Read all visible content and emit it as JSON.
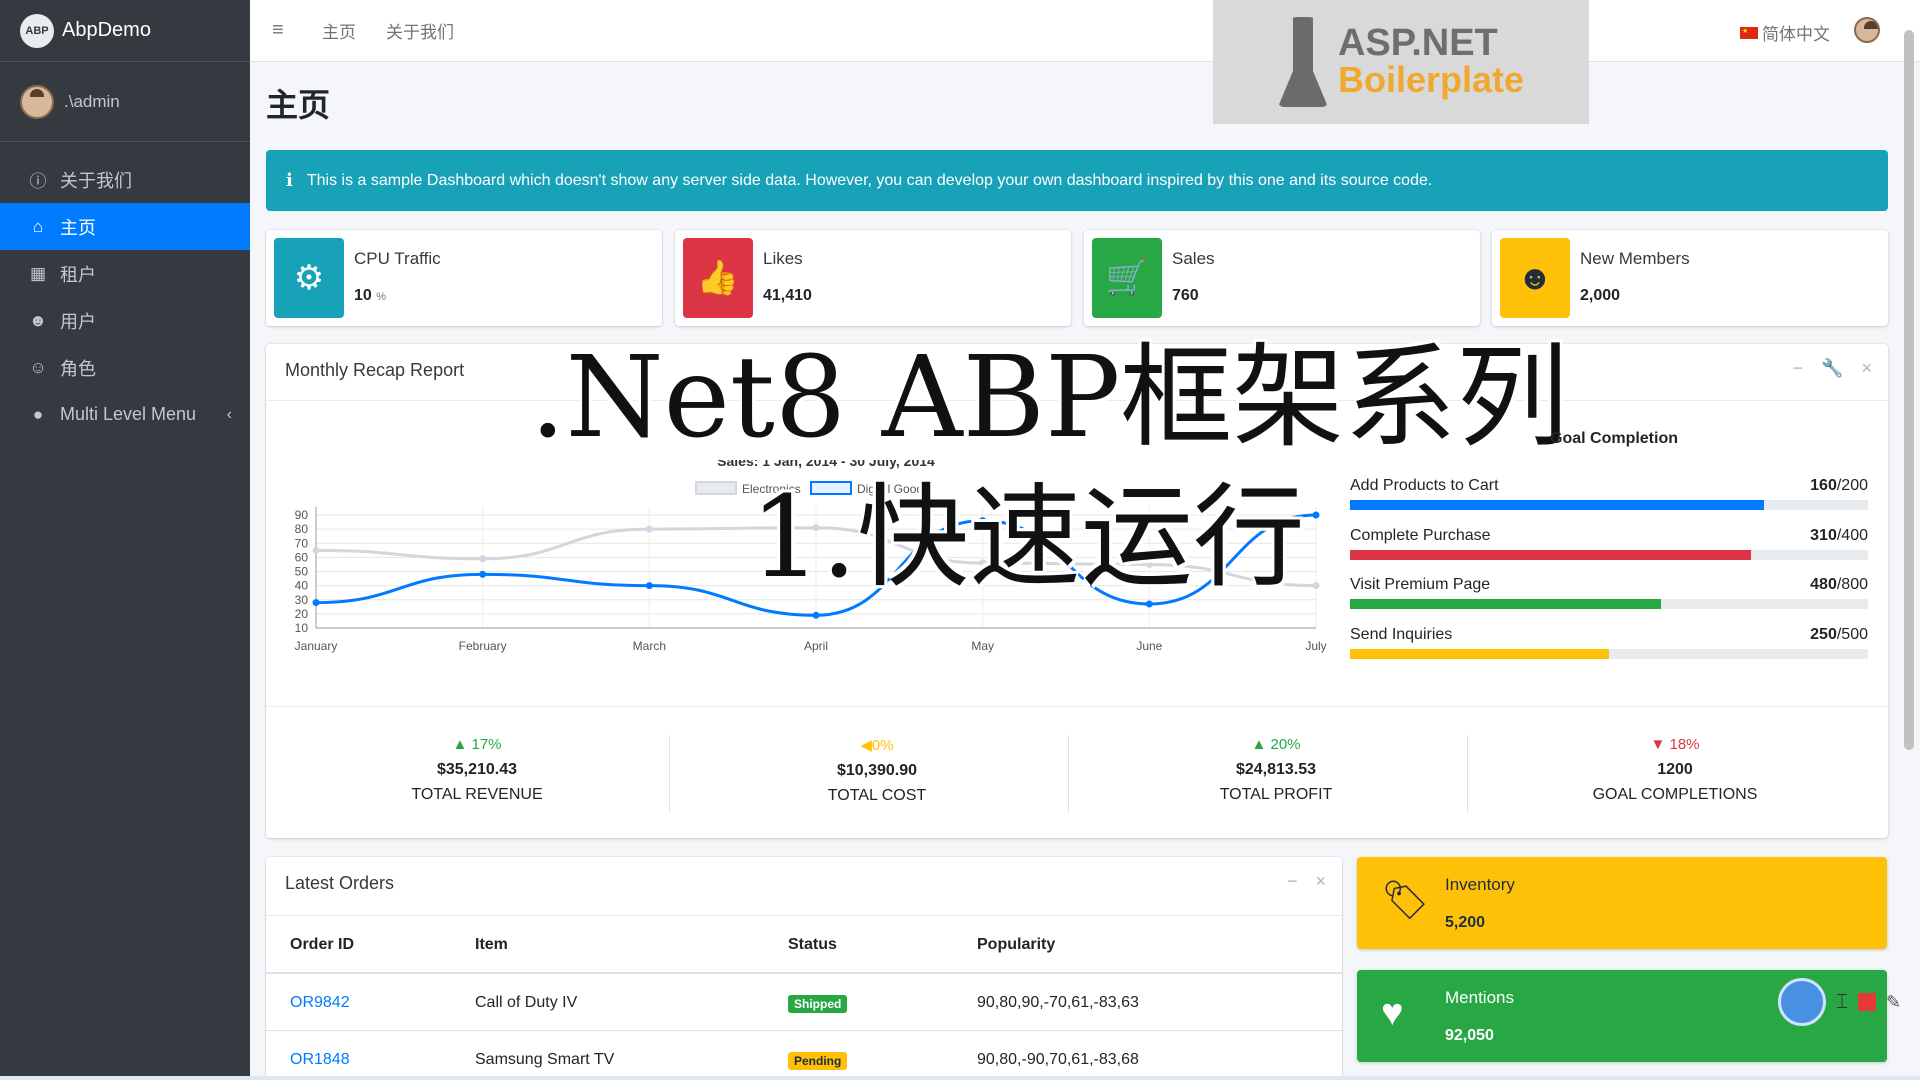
{
  "sidebar": {
    "brand": "AbpDemo",
    "brand_logo": "ABP",
    "user": ".\\admin",
    "items": [
      {
        "label": "关于我们",
        "icon": "info-circle-icon"
      },
      {
        "label": "主页",
        "icon": "home-icon"
      },
      {
        "label": "租户",
        "icon": "building-icon"
      },
      {
        "label": "用户",
        "icon": "users-icon"
      },
      {
        "label": "角色",
        "icon": "theater-masks-icon"
      },
      {
        "label": "Multi Level Menu",
        "icon": "circle-icon"
      }
    ]
  },
  "topbar": {
    "links": [
      "主页",
      "关于我们"
    ],
    "language": "简体中文"
  },
  "watermark": {
    "line1": "ASP.NET",
    "line2": "Boilerplate"
  },
  "page_title": "主页",
  "alert": "This is a sample Dashboard which doesn't show any server side data. However, you can develop your own dashboard inspired by this one and its source code.",
  "info_boxes": [
    {
      "label": "CPU Traffic",
      "value": "10",
      "unit": "%",
      "color": "#17a2b8",
      "icon": "gear-icon"
    },
    {
      "label": "Likes",
      "value": "41,410",
      "unit": "",
      "color": "#dc3545",
      "icon": "thumbs-up-icon"
    },
    {
      "label": "Sales",
      "value": "760",
      "unit": "",
      "color": "#28a745",
      "icon": "shopping-cart-icon"
    },
    {
      "label": "New Members",
      "value": "2,000",
      "unit": "",
      "color": "#ffc107",
      "icon": "users-icon"
    }
  ],
  "recap": {
    "title": "Monthly Recap Report",
    "overlay_title": ".Net8 ABP框架系列",
    "overlay_subtitle": "1.快速运行",
    "goal_title": "Goal Completion",
    "goals": [
      {
        "label": "Add Products to Cart",
        "value": "160",
        "max": "/200",
        "fraction": 0.8,
        "color": "#007bff"
      },
      {
        "label": "Complete Purchase",
        "value": "310",
        "max": "/400",
        "fraction": 0.775,
        "color": "#dc3545"
      },
      {
        "label": "Visit Premium Page",
        "value": "480",
        "max": "/800",
        "fraction": 0.6,
        "color": "#28a745"
      },
      {
        "label": "Send Inquiries",
        "value": "250",
        "max": "/500",
        "fraction": 0.5,
        "color": "#ffc107"
      }
    ],
    "stats": [
      {
        "pct": "17%",
        "dir": "up",
        "color": "#28a745",
        "amount": "$35,210.43",
        "label": "TOTAL REVENUE"
      },
      {
        "pct": "0%",
        "dir": "flat",
        "color": "#ffc107",
        "amount": "$10,390.90",
        "label": "TOTAL COST"
      },
      {
        "pct": "20%",
        "dir": "up",
        "color": "#28a745",
        "amount": "$24,813.53",
        "label": "TOTAL PROFIT"
      },
      {
        "pct": "18%",
        "dir": "down",
        "color": "#dc3545",
        "amount": "1200",
        "label": "GOAL COMPLETIONS"
      }
    ]
  },
  "chart_data": {
    "type": "line",
    "title": "Sales: 1 Jan, 2014 - 30 July, 2014",
    "categories": [
      "January",
      "February",
      "March",
      "April",
      "May",
      "June",
      "July"
    ],
    "series": [
      {
        "name": "Electronics",
        "values": [
          65,
          59,
          80,
          81,
          56,
          55,
          40
        ],
        "color": "#d2d6de"
      },
      {
        "name": "Digital Goods",
        "values": [
          28,
          48,
          40,
          19,
          86,
          27,
          90
        ],
        "color": "#007bff"
      }
    ],
    "y_ticks": [
      "10",
      "20",
      "30",
      "40",
      "50",
      "60",
      "70",
      "80",
      "90"
    ],
    "ylim": [
      10,
      90
    ],
    "legend": "top",
    "grid": true
  },
  "orders": {
    "title": "Latest Orders",
    "headers": [
      "Order ID",
      "Item",
      "Status",
      "Popularity"
    ],
    "rows": [
      {
        "id": "OR9842",
        "item": "Call of Duty IV",
        "status": "Shipped",
        "status_color": "#28a745",
        "popularity": "90,80,90,-70,61,-83,63"
      },
      {
        "id": "OR1848",
        "item": "Samsung Smart TV",
        "status": "Pending",
        "status_color": "#ffc107",
        "popularity": "90,80,-90,70,61,-83,68"
      }
    ]
  },
  "side_boxes": [
    {
      "label": "Inventory",
      "value": "5,200",
      "color": "#ffc107",
      "icon": "tag-icon"
    },
    {
      "label": "Mentions",
      "value": "92,050",
      "color": "#28a745",
      "icon": "heart-icon"
    }
  ]
}
